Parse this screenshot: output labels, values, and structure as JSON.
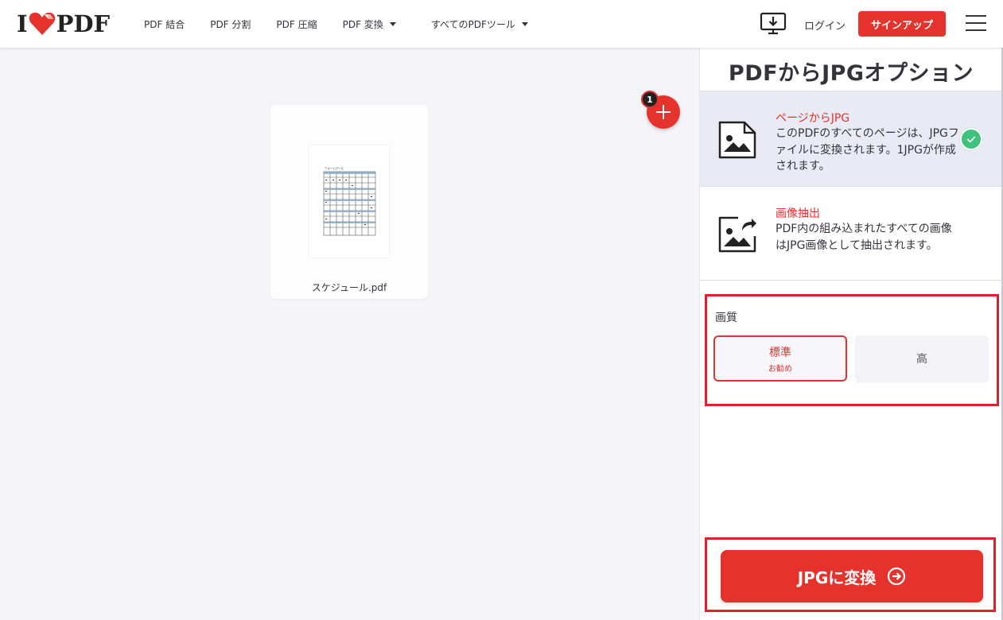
{
  "header": {
    "logo": {
      "left": "I",
      "right": "PDF"
    },
    "nav": [
      {
        "label": "PDF 結合"
      },
      {
        "label": "PDF 分割"
      },
      {
        "label": "PDF 圧縮"
      },
      {
        "label": "PDF 変換"
      },
      {
        "label": "すべてのPDFツール"
      }
    ],
    "login_label": "ログイン",
    "signup_label": "サインアップ"
  },
  "workspace": {
    "file_name": "スケジュール.pdf",
    "file_count": "1",
    "thumb_title": "フォームブース"
  },
  "sidebar": {
    "title": "PDFからJPGオプション",
    "options": [
      {
        "title": "ページからJPG",
        "desc": "このPDFのすべてのページは、JPGファイルに変換されます。1JPGが作成されます。",
        "selected": true
      },
      {
        "title": "画像抽出",
        "desc": "PDF内の組み込まれたすべての画像はJPG画像として抽出されます。",
        "selected": false
      }
    ],
    "quality": {
      "label": "画質",
      "standard": "標準",
      "standard_sub": "お勧め",
      "high": "高"
    },
    "convert_label": "JPGに変換"
  },
  "colors": {
    "accent": "#e5322d",
    "check": "#3ec27c",
    "highlight": "#e0202b"
  }
}
